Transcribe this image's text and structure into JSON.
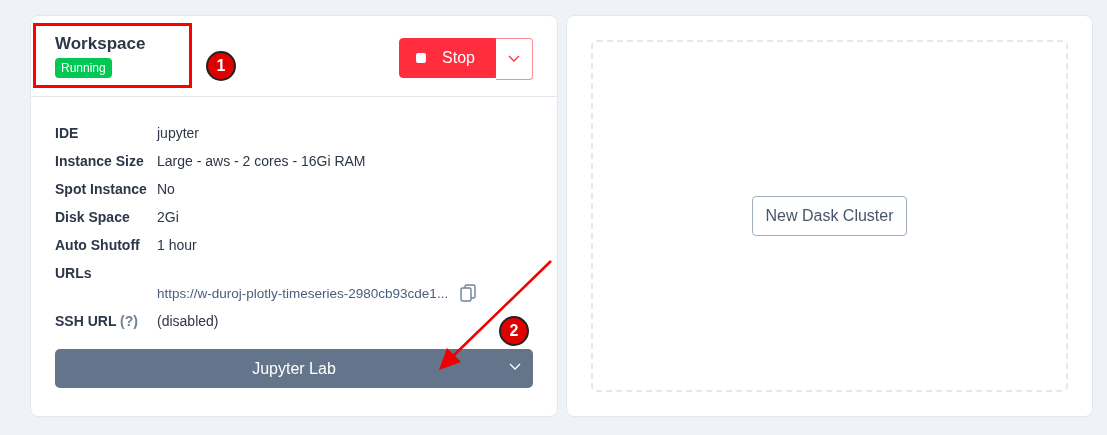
{
  "workspace": {
    "title": "Workspace",
    "status": "Running",
    "stop_button": "Stop",
    "details": [
      {
        "label": "IDE",
        "value": "jupyter",
        "kind": "text"
      },
      {
        "label": "Instance Size",
        "value": "Large - aws - 2 cores - 16Gi RAM",
        "kind": "text"
      },
      {
        "label": "Spot Instance",
        "value": "No",
        "kind": "text"
      },
      {
        "label": "Disk Space",
        "value": "2Gi",
        "kind": "text"
      },
      {
        "label": "Auto Shutoff",
        "value": "1 hour",
        "kind": "text"
      },
      {
        "label": "URLs",
        "value": "https://w-duroj-plotly-timeseries-2980cb93cde1...",
        "kind": "url"
      },
      {
        "label": "SSH URL",
        "help": "(?)",
        "value": "(disabled)",
        "kind": "text"
      }
    ],
    "open_button": "Jupyter Lab"
  },
  "dask": {
    "button": "New Dask Cluster"
  },
  "annotations": [
    "1",
    "2"
  ]
}
